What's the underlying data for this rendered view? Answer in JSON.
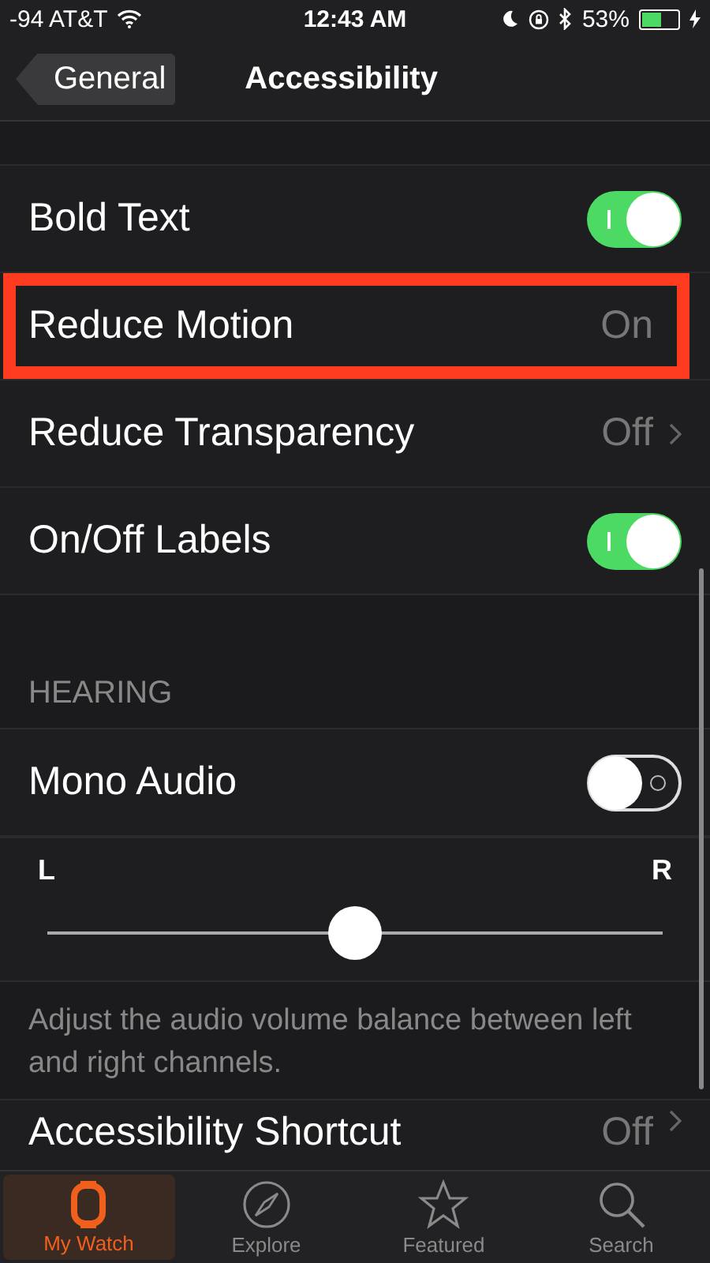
{
  "status_bar": {
    "signal": "-94 AT&T",
    "time": "12:43 AM",
    "battery": "53%"
  },
  "nav_bar": {
    "back": "General",
    "title": "Accessibility"
  },
  "rows": [
    {
      "kind": "toggle",
      "label": "Bold Text",
      "on": true,
      "highlighted": false
    },
    {
      "kind": "value",
      "label": "Reduce Motion",
      "value": "On",
      "highlighted": true
    },
    {
      "kind": "value",
      "label": "Reduce Transparency",
      "value": "Off",
      "highlighted": false
    },
    {
      "kind": "toggle",
      "label": "On/Off Labels",
      "on": true,
      "highlighted": false
    }
  ],
  "hearing": {
    "header": "HEARING",
    "mono_audio": {
      "label": "Mono Audio",
      "on": false
    },
    "balance": {
      "left": "L",
      "right": "R",
      "level": 0.5
    },
    "footer": "Adjust the audio volume balance between left and right channels."
  },
  "bottom_row": {
    "label": "Accessibility Shortcut",
    "value": "Off"
  },
  "tabs": [
    {
      "label": "My Watch",
      "selected": true
    },
    {
      "label": "Explore",
      "selected": false
    },
    {
      "label": "Featured",
      "selected": false
    },
    {
      "label": "Search",
      "selected": false
    }
  ]
}
